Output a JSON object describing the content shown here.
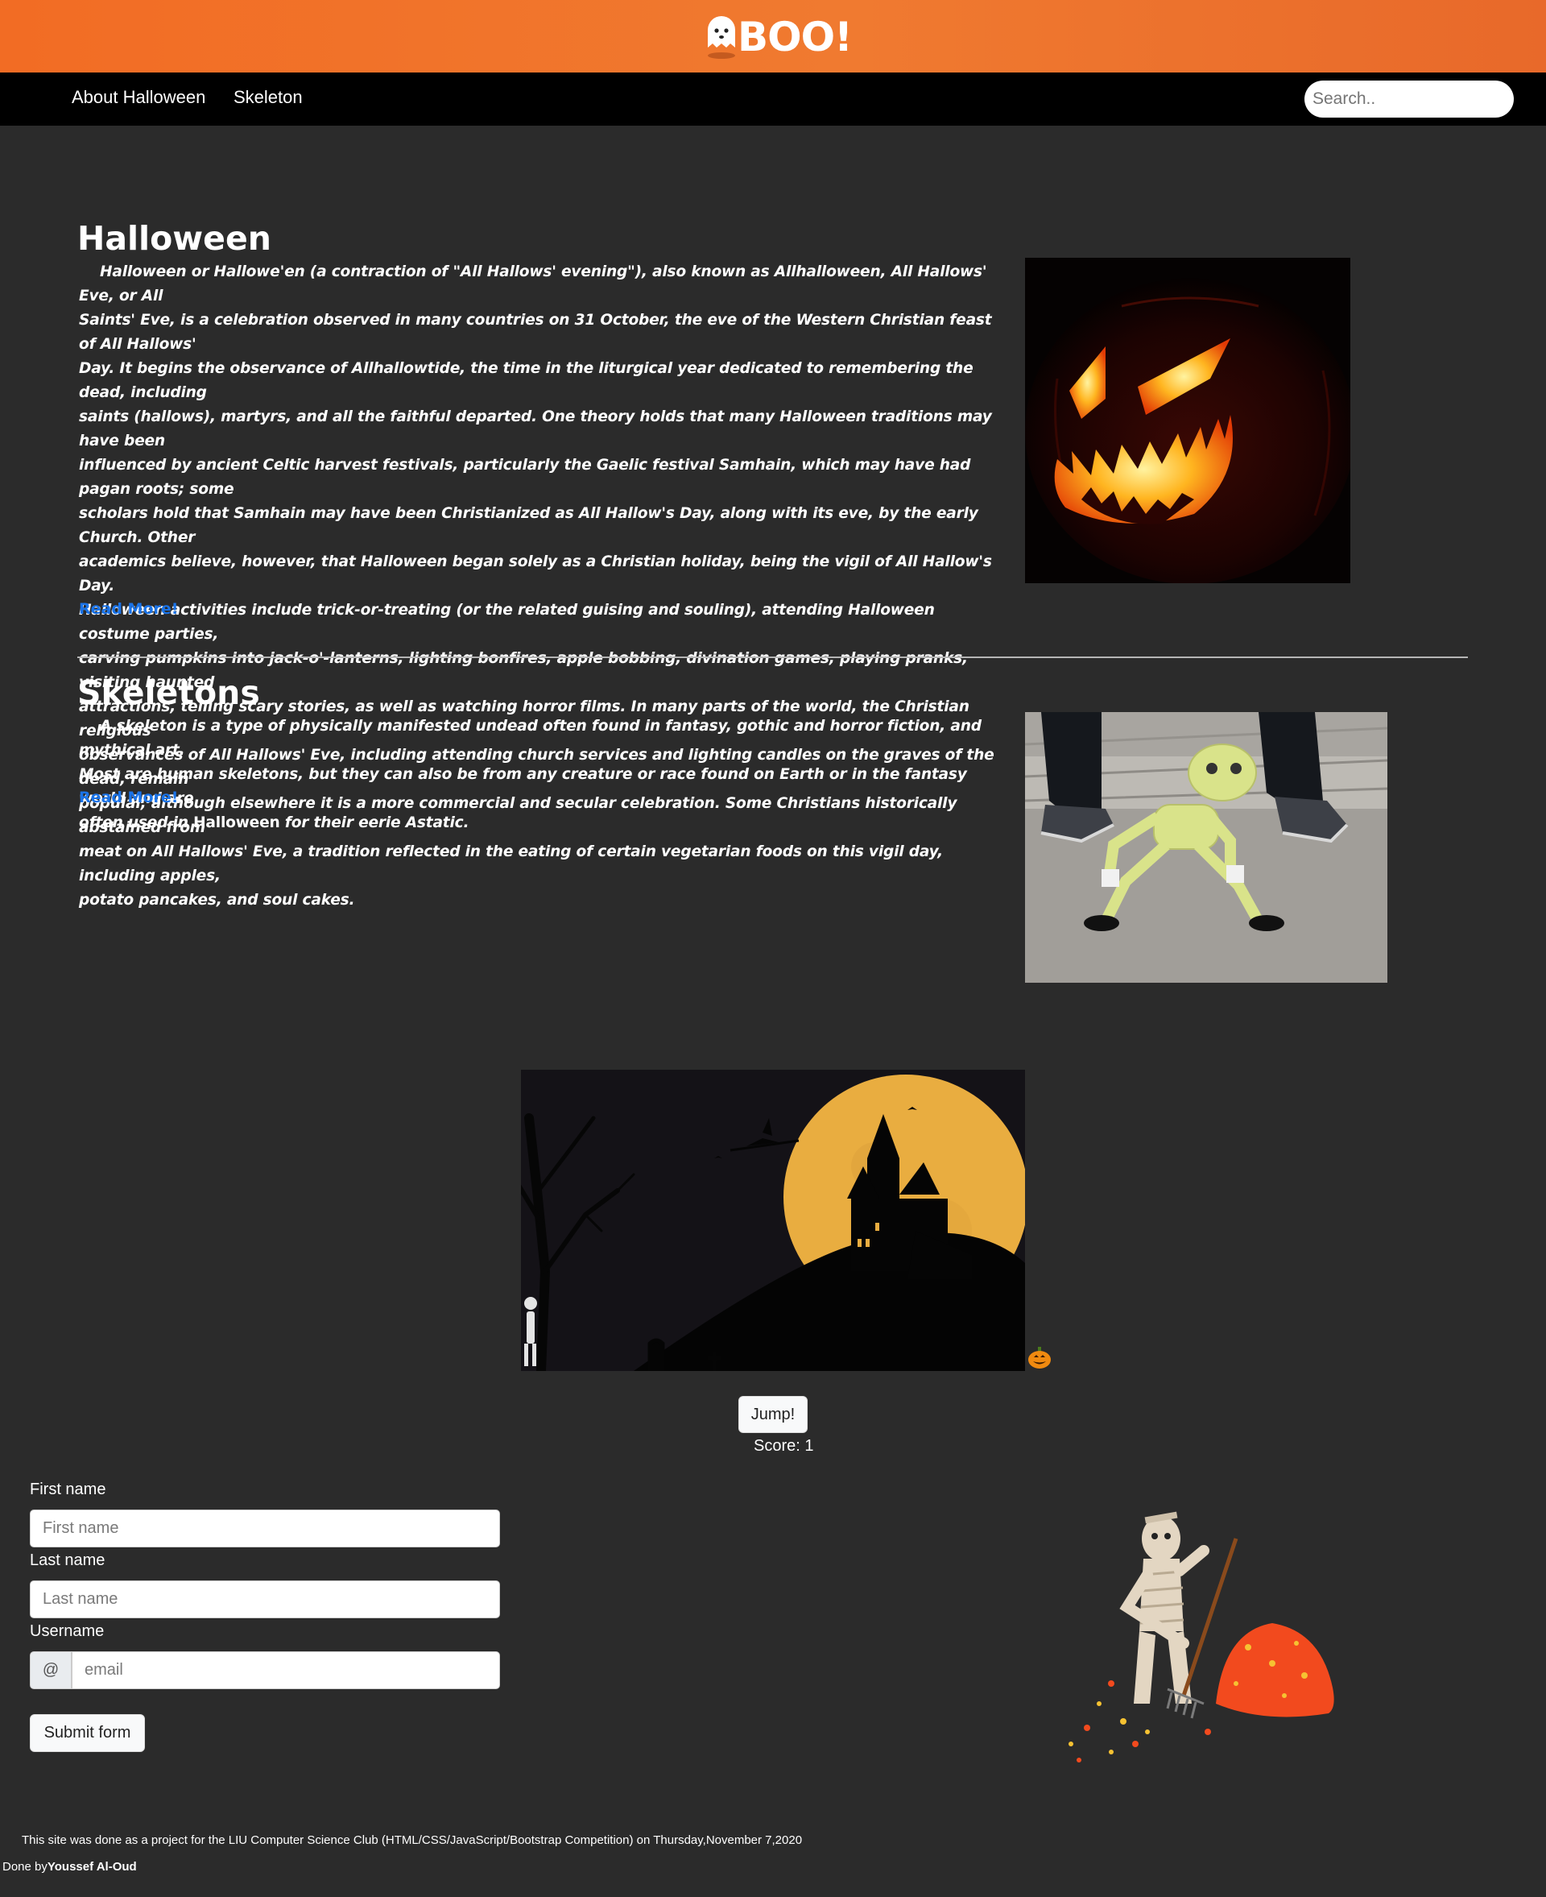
{
  "header": {
    "logo_text": "BOO!"
  },
  "nav": {
    "links": [
      "About Halloween",
      "Skeleton"
    ],
    "search_placeholder": "Search.."
  },
  "halloween": {
    "title": "Halloween",
    "lines": [
      "Halloween or Hallowe'en (a contraction of \"All Hallows' evening\"), also known as Allhalloween, All Hallows' Eve, or All",
      "Saints' Eve, is a celebration observed in many countries on 31 October, the eve of the Western Christian feast of All Hallows'",
      "Day. It begins the observance of Allhallowtide, the time in the liturgical year dedicated to remembering the dead, including",
      "saints (hallows), martyrs, and all the faithful departed. One theory holds that many Halloween traditions may have been",
      "influenced by ancient Celtic harvest festivals, particularly the Gaelic festival Samhain, which may have had pagan roots; some",
      "scholars hold that Samhain may have been Christianized as All Hallow's Day, along with its eve, by the early Church. Other",
      "academics believe, however, that Halloween began solely as a Christian holiday, being the vigil of All Hallow's Day.",
      "Halloween activities include trick-or-treating (or the related guising and souling), attending Halloween costume parties,",
      "carving pumpkins into jack-o'-lanterns, lighting bonfires, apple bobbing, divination games, playing pranks, visiting haunted",
      "attractions, telling scary stories, as well as watching horror films. In many parts of the world, the Christian religious",
      "observances of All Hallows' Eve, including attending church services and lighting candles on the graves of the dead, remain",
      "popular, although elsewhere it is a more commercial and secular celebration. Some Christians historically abstained from",
      "meat on All Hallows' Eve, a tradition reflected in the eating of certain vegetarian foods on this vigil day, including apples,",
      "potato pancakes, and soul cakes."
    ],
    "read_more": "Read More!"
  },
  "skeletons": {
    "title": "Skeletons",
    "line1": "A skeleton is a type of physically manifested undead often found in fantasy, gothic and horror fiction, and mythical art.",
    "line2": "Most are human skeletons, but they can also be from any creature or race found on Earth or in the fantasy world and are",
    "line3_pre": "often used in ",
    "line3_bold": "Halloween",
    "line3_post": " for their eerie Astatic.",
    "read_more": "Read More!"
  },
  "game": {
    "jump_label": "Jump!",
    "score_text": "Score: 1"
  },
  "form": {
    "first_label": "First name",
    "first_placeholder": "First name",
    "last_label": "Last name",
    "last_placeholder": "Last name",
    "username_label": "Username",
    "at_symbol": "@",
    "email_placeholder": "email",
    "submit_label": "Submit form"
  },
  "footer": {
    "text": "This site was done as a project for the LIU Computer Science Club (HTML/CSS/JavaScript/Bootstrap Competition) on Thursday,November 7,2020",
    "done_by": "Done by",
    "author": "Youssef Al-Oud"
  },
  "colors": {
    "header_orange": "#f26c24",
    "navbar": "#000000",
    "page_bg": "#2b2b2b",
    "link_blue": "#1a73e8"
  },
  "icons": [
    "ghost-icon",
    "jack-o-lantern-image",
    "dancing-skeleton-image",
    "haunted-castle-scene",
    "pumpkin-icon",
    "mummy-raking-leaves-image"
  ]
}
